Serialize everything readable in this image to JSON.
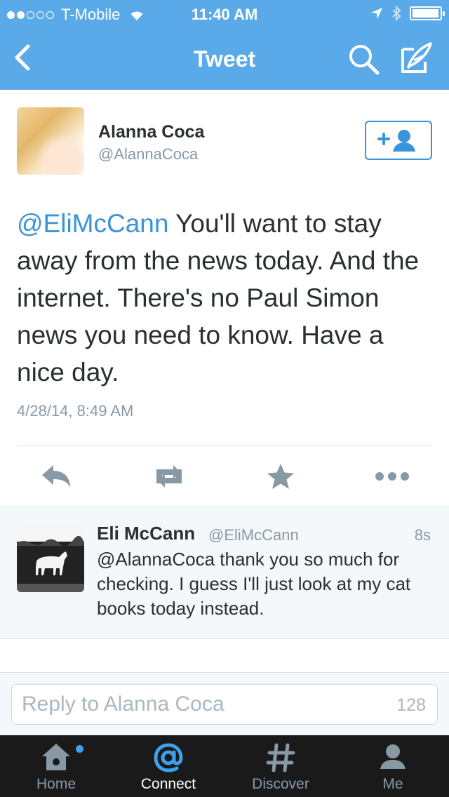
{
  "status_bar": {
    "carrier": "T-Mobile",
    "time": "11:40 AM",
    "signal_bars_filled": 2,
    "signal_bars_total": 5,
    "battery_level": 0.98
  },
  "nav": {
    "title": "Tweet",
    "icons": [
      "back-chevron-icon",
      "search-icon",
      "compose-icon"
    ]
  },
  "tweet": {
    "author_name": "Alanna Coca",
    "author_handle": "@AlannaCoca",
    "mention": "@EliMcCann",
    "text": " You'll want to stay away from the news today. And the internet.  There's no Paul Simon news you need to know. Have a nice day.",
    "timestamp": "4/28/14, 8:49 AM",
    "follow_icon": "add-user-icon"
  },
  "actions": [
    "reply-icon",
    "retweet-icon",
    "favorite-icon",
    "more-icon"
  ],
  "reply": {
    "name": "Eli McCann",
    "handle": "@EliMcCann",
    "time": "8s",
    "text": "@AlannaCoca thank you so much for checking. I guess I'll just look at my cat books today instead."
  },
  "compose": {
    "placeholder": "Reply to Alanna Coca",
    "char_count": "128"
  },
  "tabs": [
    {
      "label": "Home",
      "icon": "home-icon",
      "active": false,
      "badge": true
    },
    {
      "label": "Connect",
      "icon": "at-icon",
      "active": true,
      "badge": false
    },
    {
      "label": "Discover",
      "icon": "hashtag-icon",
      "active": false,
      "badge": false
    },
    {
      "label": "Me",
      "icon": "person-icon",
      "active": false,
      "badge": false
    }
  ],
  "colors": {
    "header": "#5aaaea",
    "link": "#3b94d9",
    "text": "#292f33",
    "muted": "#8899a6",
    "tabbar": "#1a1a1a",
    "active_tab_icon": "#3ea1ec"
  }
}
